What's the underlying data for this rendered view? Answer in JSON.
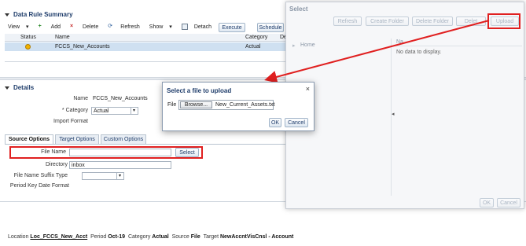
{
  "summary": {
    "title": "Data Rule Summary",
    "toolbar": {
      "view": "View",
      "add": "Add",
      "delete": "Delete",
      "refresh": "Refresh",
      "show": "Show",
      "detach": "Detach",
      "execute": "Execute",
      "schedule": "Schedule"
    },
    "columns": {
      "status": "Status",
      "name": "Name",
      "category": "Category",
      "desc": "De"
    },
    "row": {
      "name": "FCCS_New_Accounts",
      "category": "Actual"
    }
  },
  "details": {
    "title": "Details",
    "name_label": "Name",
    "name_value": "FCCS_New_Accounts",
    "category_label": "* Category",
    "category_value": "Actual",
    "import_format_label": "Import Format",
    "tabs": [
      "Source Options",
      "Target Options",
      "Custom Options"
    ],
    "file_name_label": "File Name",
    "select_button": "Select",
    "directory_label": "Directory",
    "directory_value": "inbox",
    "file_name_suffix_label": "File Name Suffix Type",
    "period_key_label": "Period Key Date Format"
  },
  "select_panel": {
    "title": "Select",
    "buttons": {
      "refresh": "Refresh",
      "create_folder": "Create Folder",
      "delete_folder": "Delete Folder",
      "delete": "Delet",
      "upload": "Upload"
    },
    "tree_home": "Home",
    "table_header": "Na",
    "empty_text": "No data to display.",
    "ok": "OK",
    "cancel": "Cancel"
  },
  "upload_modal": {
    "title": "Select a file to upload",
    "file_label": "File",
    "browse": "Browse...",
    "filename": "New_Current_Assets.txt",
    "ok": "OK",
    "cancel": "Cancel",
    "close_symbol": "×"
  },
  "status_bar": {
    "location_label": "Location",
    "location_value": "Loc_FCCS_New_Acct",
    "period_label": "Period",
    "period_value": "Oct-19",
    "category_label": "Category",
    "category_value": "Actual",
    "source_label": "Source",
    "source_value": "File",
    "target_label": "Target",
    "target_value": "NewAccntVisCnsl - Account"
  },
  "colors": {
    "red_highlight": "#e02020",
    "header_blue": "#1f3d6b"
  }
}
